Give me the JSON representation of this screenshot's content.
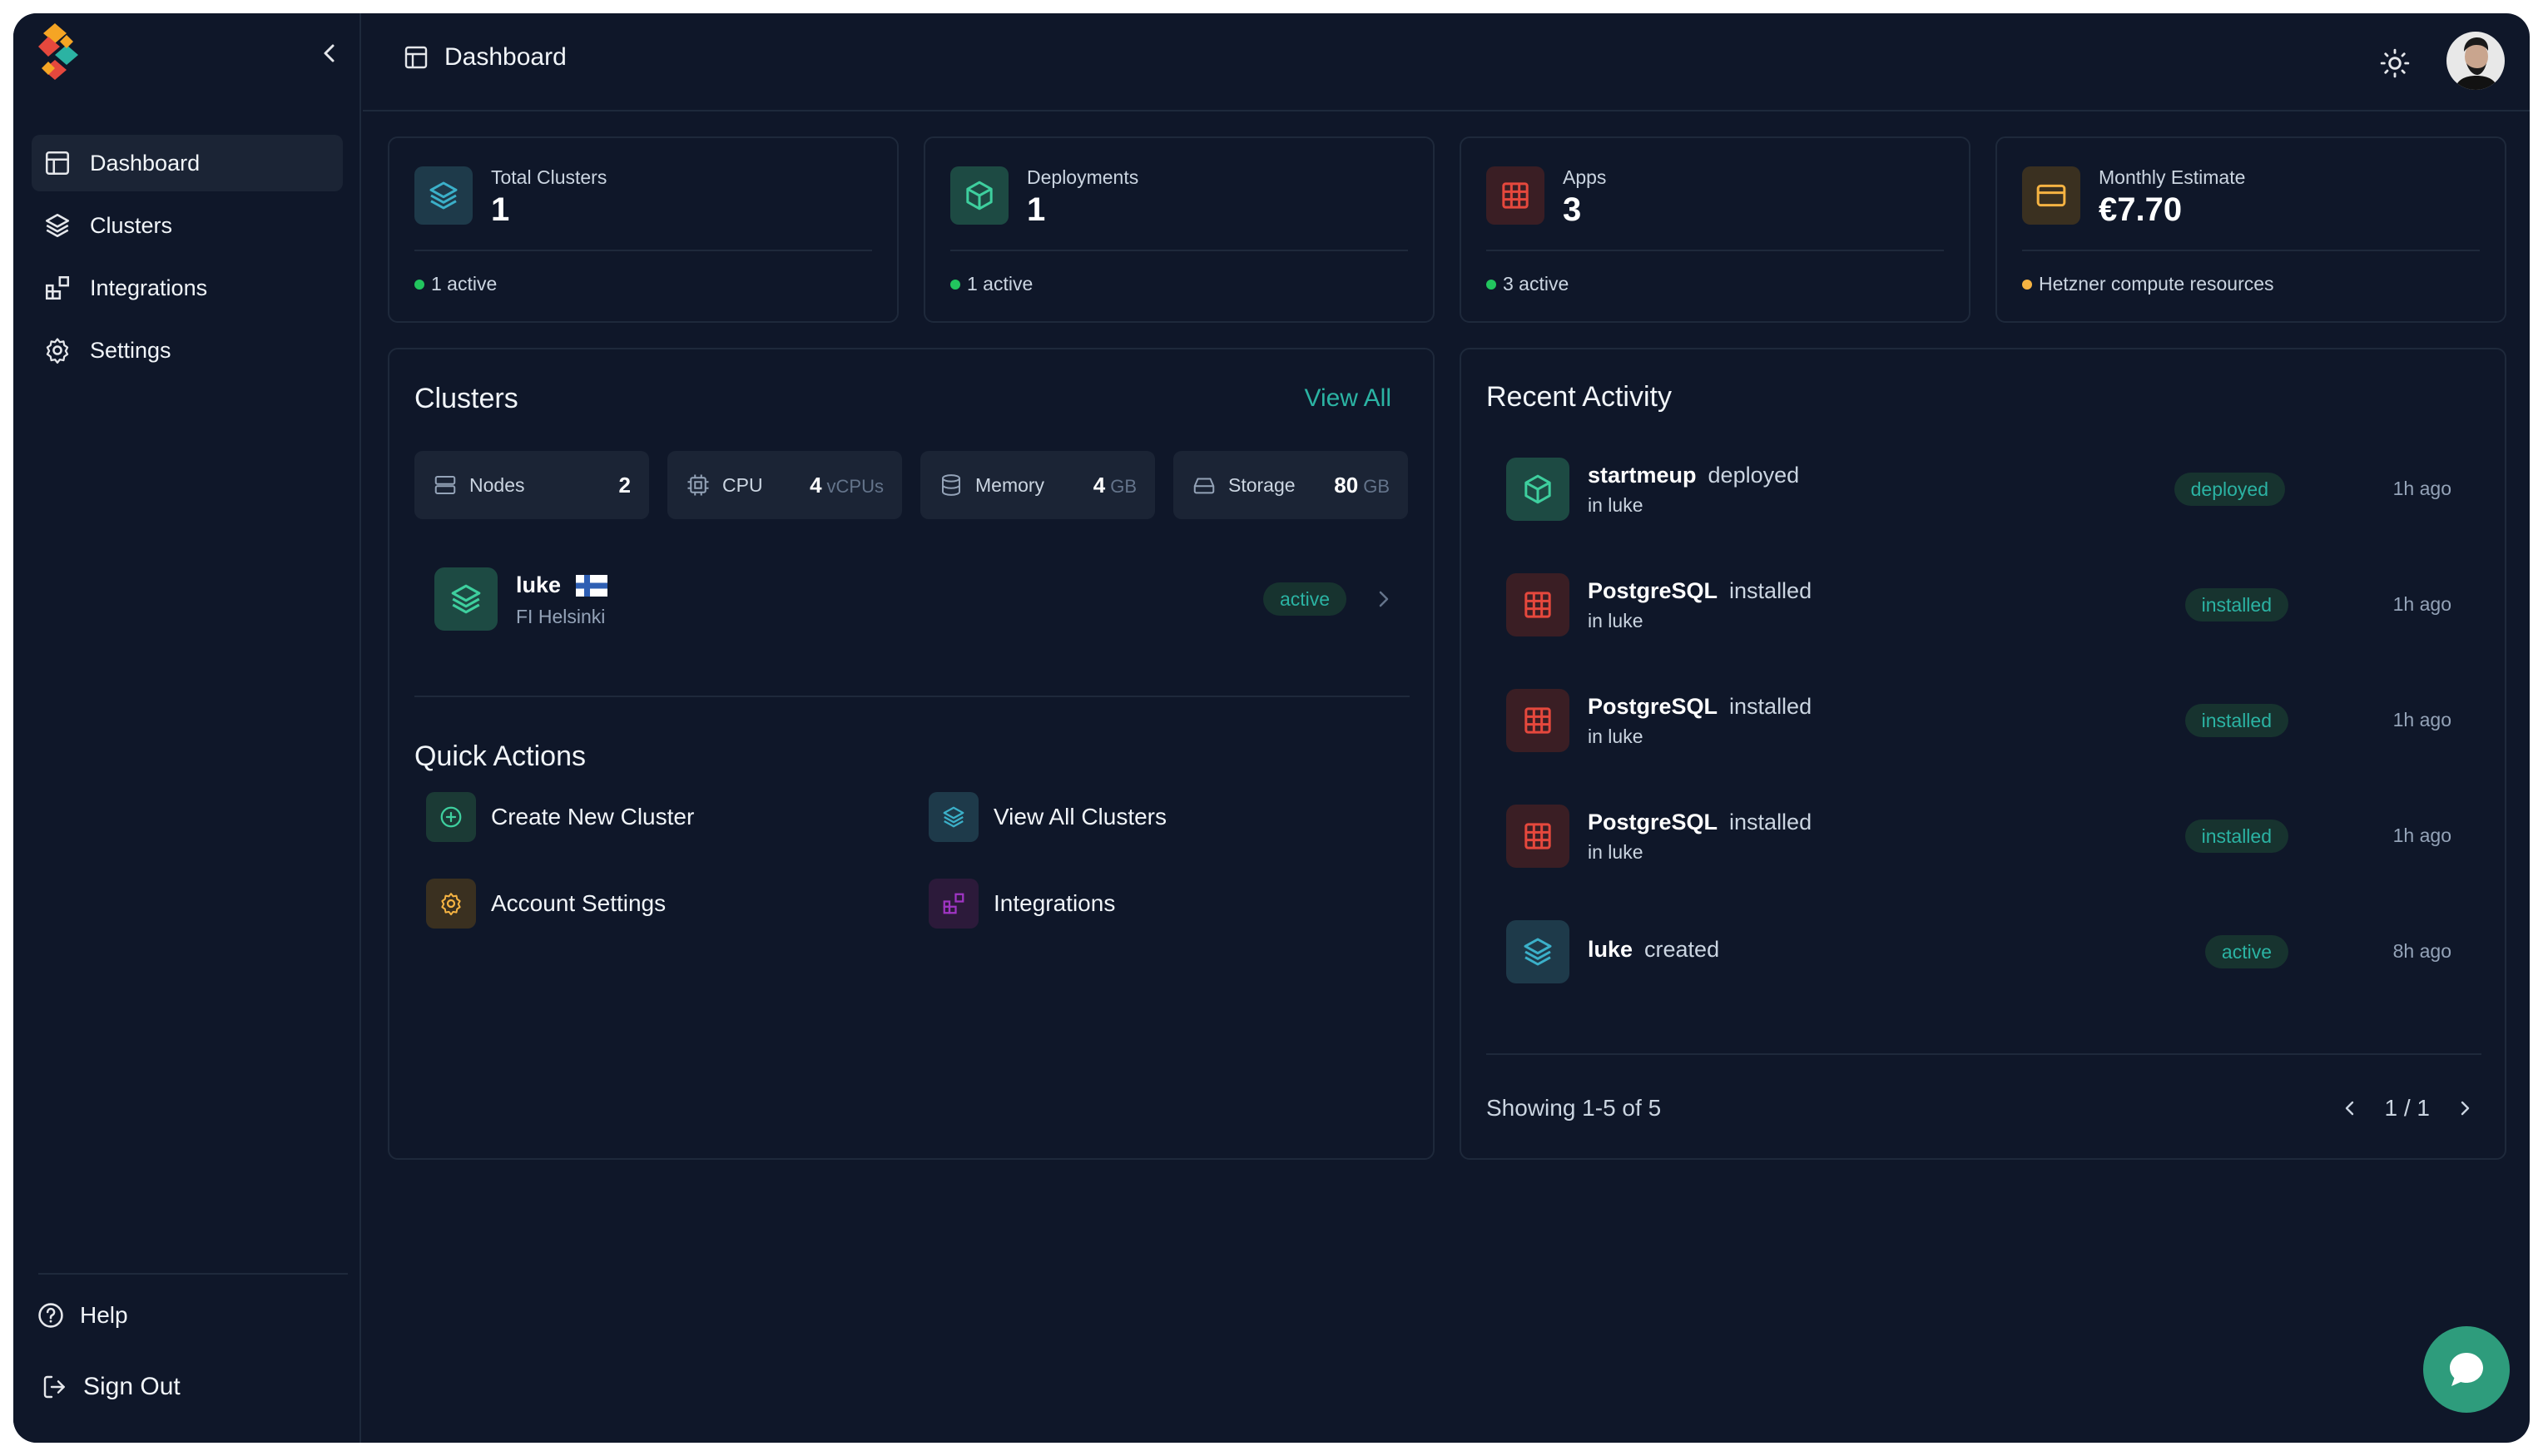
{
  "sidebar": {
    "nav": [
      {
        "label": "Dashboard",
        "icon": "layout-icon"
      },
      {
        "label": "Clusters",
        "icon": "layers-icon"
      },
      {
        "label": "Integrations",
        "icon": "blocks-icon"
      },
      {
        "label": "Settings",
        "icon": "gear-icon"
      }
    ],
    "help_label": "Help",
    "signout_label": "Sign Out"
  },
  "header": {
    "title": "Dashboard"
  },
  "stats": [
    {
      "label": "Total Clusters",
      "value": "1",
      "foot": "1 active",
      "dot_color": "#22c55e"
    },
    {
      "label": "Deployments",
      "value": "1",
      "foot": "1 active",
      "dot_color": "#22c55e"
    },
    {
      "label": "Apps",
      "value": "3",
      "foot": "3 active",
      "dot_color": "#22c55e"
    },
    {
      "label": "Monthly Estimate",
      "value": "€7.70",
      "foot": "Hetzner compute resources",
      "dot_color": "#f5b342"
    }
  ],
  "clusters_panel": {
    "title": "Clusters",
    "view_all": "View All",
    "metrics": [
      {
        "label": "Nodes",
        "value": "2",
        "unit": ""
      },
      {
        "label": "CPU",
        "value": "4",
        "unit": "vCPUs"
      },
      {
        "label": "Memory",
        "value": "4",
        "unit": "GB"
      },
      {
        "label": "Storage",
        "value": "80",
        "unit": "GB"
      }
    ],
    "cluster": {
      "name": "luke",
      "location": "FI Helsinki",
      "status": "active"
    },
    "quick_actions_title": "Quick Actions",
    "quick_actions": [
      {
        "label": "Create New Cluster",
        "icon": "plus-circle-icon"
      },
      {
        "label": "View All Clusters",
        "icon": "layers-icon"
      },
      {
        "label": "Account Settings",
        "icon": "gear-icon"
      },
      {
        "label": "Integrations",
        "icon": "blocks-icon"
      }
    ]
  },
  "activity_panel": {
    "title": "Recent Activity",
    "items": [
      {
        "name": "startmeup",
        "action": "deployed",
        "context": "in luke",
        "badge": "deployed",
        "time": "1h ago",
        "icon": "box-icon"
      },
      {
        "name": "PostgreSQL",
        "action": "installed",
        "context": "in luke",
        "badge": "installed",
        "time": "1h ago",
        "icon": "grid-icon"
      },
      {
        "name": "PostgreSQL",
        "action": "installed",
        "context": "in luke",
        "badge": "installed",
        "time": "1h ago",
        "icon": "grid-icon"
      },
      {
        "name": "PostgreSQL",
        "action": "installed",
        "context": "in luke",
        "badge": "installed",
        "time": "1h ago",
        "icon": "grid-icon"
      },
      {
        "name": "luke",
        "action": "created",
        "context": "",
        "badge": "active",
        "time": "8h ago",
        "icon": "layers-icon"
      }
    ],
    "showing": "Showing 1-5 of 5",
    "page": "1 / 1"
  },
  "colors": {
    "background": "#0f1729",
    "accent_teal": "#2bb3a3",
    "red": "#e5483d",
    "amber": "#f5b342",
    "purple": "#a035c4"
  }
}
